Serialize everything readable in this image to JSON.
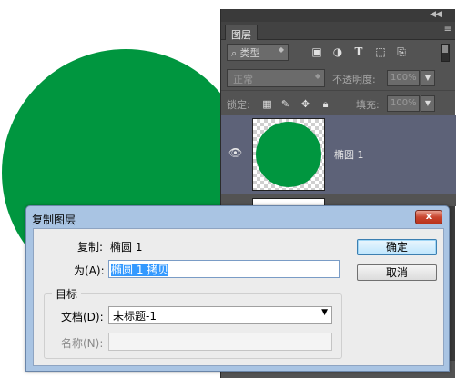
{
  "canvas": {
    "shape_color": "#00963f"
  },
  "layers_panel": {
    "tab_label": "图层",
    "filter_label": "类型",
    "blend_mode": "正常",
    "opacity_label": "不透明度:",
    "opacity_value": "100%",
    "lock_label": "锁定:",
    "fill_label": "填充:",
    "fill_value": "100%",
    "layer_name": "椭圆 1",
    "icons": [
      "collapse-icon",
      "panel-menu-icon",
      "search-icon",
      "image-filter-icon",
      "adjustment-filter-icon",
      "type-filter-icon",
      "shape-filter-icon",
      "smart-object-filter-icon",
      "eye-icon",
      "lock-transparent-icon",
      "lock-brush-icon",
      "lock-move-icon",
      "lock-all-icon"
    ]
  },
  "dialog": {
    "title": "复制图层",
    "close_label": "x",
    "duplicate_label": "复制:",
    "duplicate_value": "椭圆 1",
    "as_label": "为(A):",
    "as_value": "椭圆 1 拷贝",
    "ok_label": "确定",
    "cancel_label": "取消",
    "destination_label": "目标",
    "document_label": "文档(D):",
    "document_value": "未标题-1",
    "name_label": "名称(N):",
    "name_value": ""
  }
}
